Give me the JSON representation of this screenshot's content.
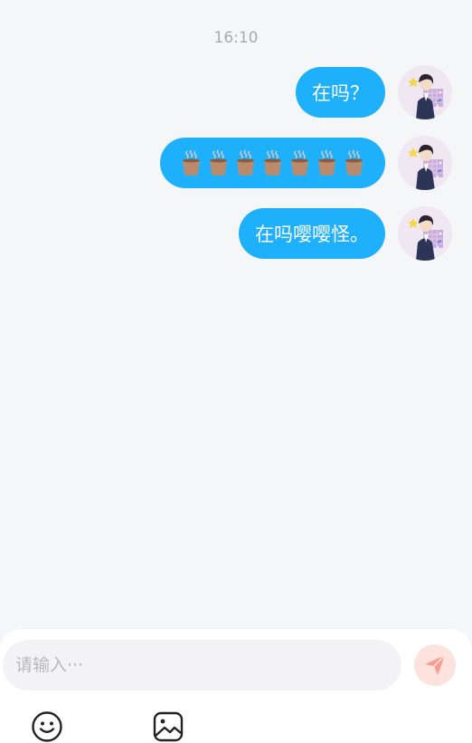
{
  "chat": {
    "time": "16:10",
    "messages": [
      {
        "type": "text",
        "text": "在吗？",
        "sender": "self"
      },
      {
        "type": "emoji",
        "emoji": "coffee-cup",
        "count": 7,
        "sender": "self"
      },
      {
        "type": "text",
        "text": "在吗嘤嘤怪。",
        "sender": "self"
      }
    ]
  },
  "composer": {
    "placeholder": "请输入···",
    "value": ""
  },
  "colors": {
    "bubble": "#1fb0fb",
    "background": "#f5f6f8",
    "send_button": "#fde2dd",
    "send_icon": "#fa9d90"
  },
  "icons": {
    "send": "paper-plane-icon",
    "emoji": "smiley-icon",
    "image": "image-icon"
  }
}
